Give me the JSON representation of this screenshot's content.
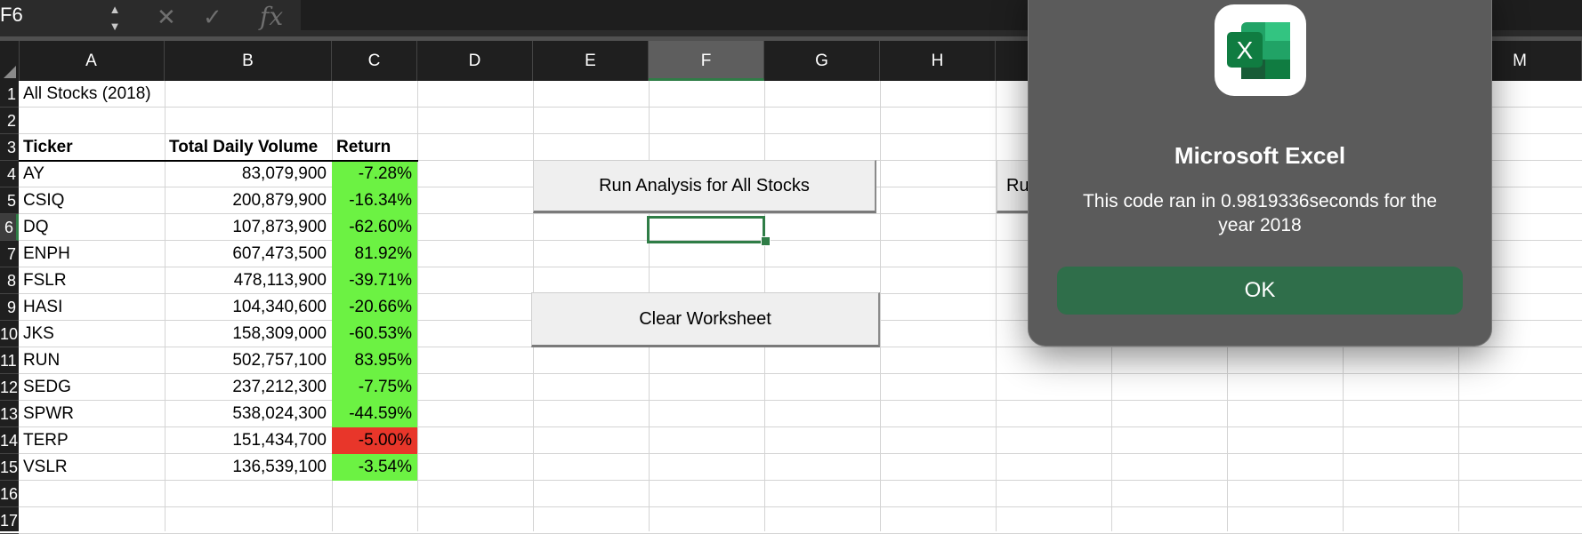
{
  "formula_bar": {
    "name_box": "F6",
    "stepper": "▲▼",
    "cancel_glyph": "✕",
    "enter_glyph": "✓",
    "function_glyph": "fx",
    "formula": ""
  },
  "columns": [
    "A",
    "B",
    "C",
    "D",
    "E",
    "F",
    "G",
    "H",
    "",
    "",
    "",
    "",
    "M"
  ],
  "selected_column": "F",
  "rows": [
    "1",
    "2",
    "3",
    "4",
    "5",
    "6",
    "7",
    "8",
    "9",
    "10",
    "11",
    "12",
    "13",
    "14",
    "15",
    "16",
    "17"
  ],
  "selected_row": "6",
  "sheet": {
    "title": "All Stocks (2018)",
    "headers": {
      "ticker": "Ticker",
      "volume": "Total Daily Volume",
      "return": "Return"
    },
    "stocks": [
      {
        "ticker": "AY",
        "volume": "83,079,900",
        "return": "-7.28%",
        "color": "#6cf243"
      },
      {
        "ticker": "CSIQ",
        "volume": "200,879,900",
        "return": "-16.34%",
        "color": "#6cf243"
      },
      {
        "ticker": "DQ",
        "volume": "107,873,900",
        "return": "-62.60%",
        "color": "#6cf243"
      },
      {
        "ticker": "ENPH",
        "volume": "607,473,500",
        "return": "81.92%",
        "color": "#6cf243"
      },
      {
        "ticker": "FSLR",
        "volume": "478,113,900",
        "return": "-39.71%",
        "color": "#6cf243"
      },
      {
        "ticker": "HASI",
        "volume": "104,340,600",
        "return": "-20.66%",
        "color": "#6cf243"
      },
      {
        "ticker": "JKS",
        "volume": "158,309,000",
        "return": "-60.53%",
        "color": "#6cf243"
      },
      {
        "ticker": "RUN",
        "volume": "502,757,100",
        "return": "83.95%",
        "color": "#6cf243"
      },
      {
        "ticker": "SEDG",
        "volume": "237,212,300",
        "return": "-7.75%",
        "color": "#6cf243"
      },
      {
        "ticker": "SPWR",
        "volume": "538,024,300",
        "return": "-44.59%",
        "color": "#6cf243"
      },
      {
        "ticker": "TERP",
        "volume": "151,434,700",
        "return": "-5.00%",
        "color": "#e8362a"
      },
      {
        "ticker": "VSLR",
        "volume": "136,539,100",
        "return": "-3.54%",
        "color": "#6cf243"
      }
    ]
  },
  "buttons": {
    "run_all": "Run Analysis for All Stocks",
    "clear": "Clear Worksheet",
    "partial_run": "Ru"
  },
  "dialog": {
    "icon": "excel-app-icon",
    "icon_letter": "X",
    "title": "Microsoft Excel",
    "message": "This code ran in 0.9819336seconds for the year 2018",
    "ok": "OK"
  },
  "colors": {
    "positive_fill": "#6cf243",
    "negative_fill": "#e8362a",
    "excel_green": "#2f6e4a"
  }
}
